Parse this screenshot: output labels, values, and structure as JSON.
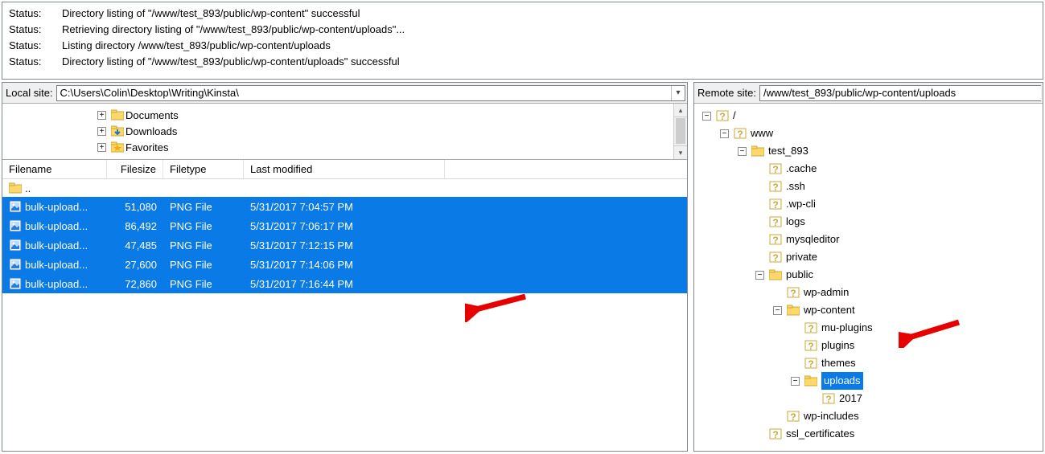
{
  "status": {
    "label": "Status:",
    "lines": [
      "Directory listing of \"/www/test_893/public/wp-content\" successful",
      "Retrieving directory listing of \"/www/test_893/public/wp-content/uploads\"...",
      "Listing directory /www/test_893/public/wp-content/uploads",
      "Directory listing of \"/www/test_893/public/wp-content/uploads\" successful"
    ]
  },
  "local": {
    "site_label": "Local site:",
    "path": "C:\\Users\\Colin\\Desktop\\Writing\\Kinsta\\",
    "tree_items": [
      {
        "name": "Documents",
        "type": "folder"
      },
      {
        "name": "Downloads",
        "type": "folder-dl"
      },
      {
        "name": "Favorites",
        "type": "favorites"
      }
    ],
    "columns": {
      "filename": "Filename",
      "filesize": "Filesize",
      "filetype": "Filetype",
      "lastmod": "Last modified"
    },
    "parent_row": "..",
    "files": [
      {
        "name": "bulk-upload...",
        "size": "51,080",
        "type": "PNG File",
        "mod": "5/31/2017 7:04:57 PM"
      },
      {
        "name": "bulk-upload...",
        "size": "86,492",
        "type": "PNG File",
        "mod": "5/31/2017 7:06:17 PM"
      },
      {
        "name": "bulk-upload...",
        "size": "47,485",
        "type": "PNG File",
        "mod": "5/31/2017 7:12:15 PM"
      },
      {
        "name": "bulk-upload...",
        "size": "27,600",
        "type": "PNG File",
        "mod": "5/31/2017 7:14:06 PM"
      },
      {
        "name": "bulk-upload...",
        "size": "72,860",
        "type": "PNG File",
        "mod": "5/31/2017 7:16:44 PM"
      }
    ]
  },
  "remote": {
    "site_label": "Remote site:",
    "path": "/www/test_893/public/wp-content/uploads",
    "tree": [
      {
        "depth": 0,
        "exp": "-",
        "icon": "q",
        "name": "/"
      },
      {
        "depth": 1,
        "exp": "-",
        "icon": "q",
        "name": "www"
      },
      {
        "depth": 2,
        "exp": "-",
        "icon": "folder",
        "name": "test_893"
      },
      {
        "depth": 3,
        "exp": "",
        "icon": "q",
        "name": ".cache"
      },
      {
        "depth": 3,
        "exp": "",
        "icon": "q",
        "name": ".ssh"
      },
      {
        "depth": 3,
        "exp": "",
        "icon": "q",
        "name": ".wp-cli"
      },
      {
        "depth": 3,
        "exp": "",
        "icon": "q",
        "name": "logs"
      },
      {
        "depth": 3,
        "exp": "",
        "icon": "q",
        "name": "mysqleditor"
      },
      {
        "depth": 3,
        "exp": "",
        "icon": "q",
        "name": "private"
      },
      {
        "depth": 3,
        "exp": "-",
        "icon": "folder",
        "name": "public"
      },
      {
        "depth": 4,
        "exp": "",
        "icon": "q",
        "name": "wp-admin"
      },
      {
        "depth": 4,
        "exp": "-",
        "icon": "folder",
        "name": "wp-content"
      },
      {
        "depth": 5,
        "exp": "",
        "icon": "q",
        "name": "mu-plugins"
      },
      {
        "depth": 5,
        "exp": "",
        "icon": "q",
        "name": "plugins"
      },
      {
        "depth": 5,
        "exp": "",
        "icon": "q",
        "name": "themes"
      },
      {
        "depth": 5,
        "exp": "-",
        "icon": "folder",
        "name": "uploads",
        "selected": true
      },
      {
        "depth": 6,
        "exp": "",
        "icon": "q",
        "name": "2017"
      },
      {
        "depth": 4,
        "exp": "",
        "icon": "q",
        "name": "wp-includes"
      },
      {
        "depth": 3,
        "exp": "",
        "icon": "q",
        "name": "ssl_certificates"
      }
    ]
  }
}
